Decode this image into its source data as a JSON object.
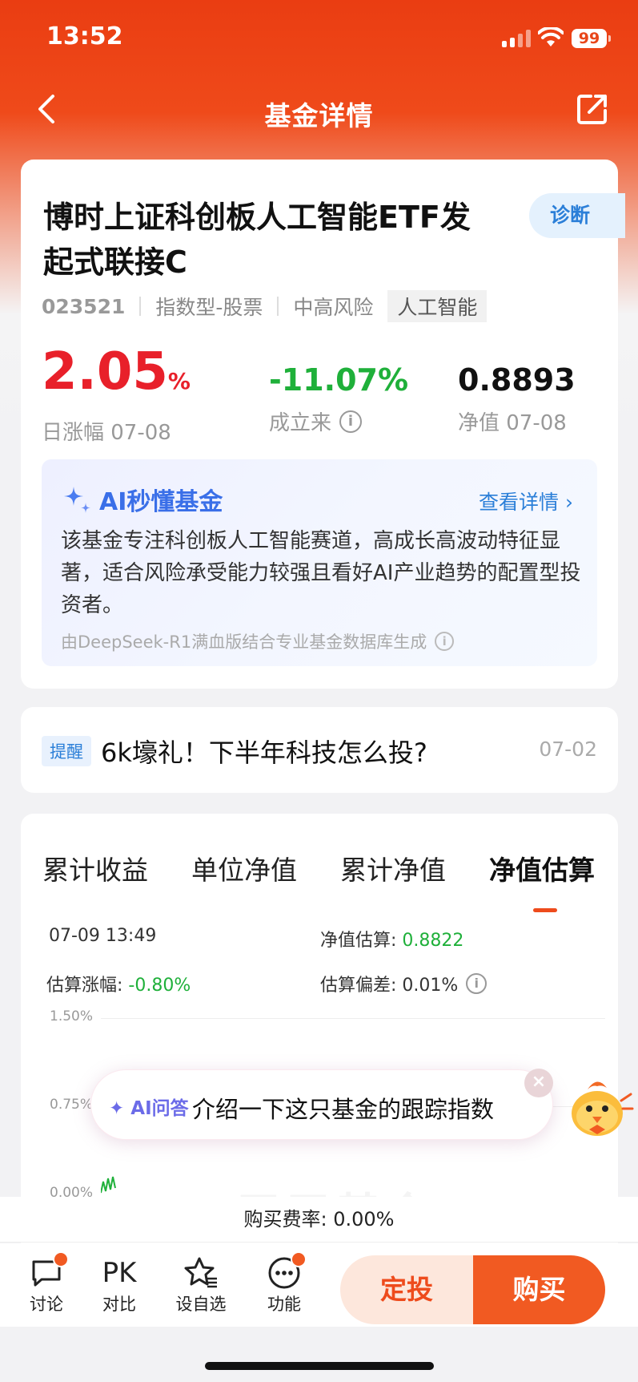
{
  "status_bar": {
    "time": "13:52",
    "battery": "99"
  },
  "nav": {
    "title": "基金详情",
    "back_icon": "chevron-left-icon",
    "share_icon": "share-icon"
  },
  "fund": {
    "name": "博时上证科创板人工智能ETF发起式联接C",
    "diagnose_label": "诊断",
    "code": "023521",
    "type": "指数型-股票",
    "risk": "中高风险",
    "theme_tag": "人工智能",
    "daily_change_value": "2.05",
    "daily_change_unit": "%",
    "daily_change_label": "日涨幅 07-08",
    "since_inception_value": "-11.07%",
    "since_inception_label": "成立来",
    "nav_value": "0.8893",
    "nav_label": "净值 07-08"
  },
  "ai_summary": {
    "title": "AI秒懂基金",
    "more_label": "查看详情",
    "text": "该基金专注科创板人工智能赛道，高成长高波动特征显著，适合风险承受能力较强且看好AI产业趋势的配置型投资者。",
    "footer": "由DeepSeek-R1满血版结合专业基金数据库生成"
  },
  "notice": {
    "tag": "提醒",
    "text": "6k壕礼！下半年科技怎么投?",
    "date": "07-02"
  },
  "chart_tabs": [
    {
      "label": "累计收益",
      "active": false
    },
    {
      "label": "单位净值",
      "active": false
    },
    {
      "label": "累计净值",
      "active": false
    },
    {
      "label": "净值估算",
      "active": true
    }
  ],
  "estimate": {
    "time": "07-09 13:49",
    "nav_label": "净值估算: ",
    "nav_value": "0.8822",
    "change_label": "估算涨幅: ",
    "change_value": "-0.80%",
    "deviation_label": "估算偏差: ",
    "deviation_value": "0.01%"
  },
  "chart_data": {
    "type": "line",
    "y_ticks": [
      "1.50%",
      "0.75%",
      "0.00%"
    ],
    "ylim": [
      0,
      1.5
    ],
    "watermark": "天天基金"
  },
  "ai_popup": {
    "tag": "AI问答",
    "text": "介绍一下这只基金的跟踪指数",
    "close_icon": "close-icon"
  },
  "fee": {
    "text": "购买费率: 0.00%"
  },
  "bottom_bar": {
    "items": [
      {
        "label": "讨论",
        "icon": "chat-bubble-icon",
        "badge": true
      },
      {
        "label": "对比",
        "icon": "pk-icon",
        "badge": false
      },
      {
        "label": "设自选",
        "icon": "star-list-icon",
        "badge": false
      },
      {
        "label": "功能",
        "icon": "more-dots-icon",
        "badge": true
      }
    ],
    "plan_label": "定投",
    "buy_label": "购买"
  },
  "colors": {
    "brand": "#ee4b1c",
    "up": "#e8202a",
    "down": "#1fb03a",
    "link": "#2b7fd8"
  }
}
